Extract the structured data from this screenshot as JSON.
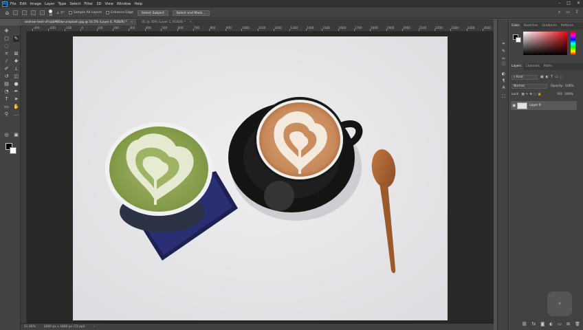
{
  "app": {
    "logo": "Ps"
  },
  "menu": [
    "File",
    "Edit",
    "Image",
    "Layer",
    "Type",
    "Select",
    "Filter",
    "3D",
    "View",
    "Window",
    "Help"
  ],
  "options": {
    "brush_size": "30",
    "sample_all_layers": "Sample All Layers",
    "enhance_edge": "Enhance Edge",
    "select_subject": "Select Subject",
    "select_and_mask": "Select and Mask..."
  },
  "tabs": [
    {
      "label": "andrew-teoh-xFsxjbM8Uw-unsplash.jpg @ 54.5% (Layer 0, RGB/8) *",
      "close": "×"
    },
    {
      "label": "01 @ 30% (Layer 1, RGB/8) *",
      "close": "×"
    }
  ],
  "ruler_labels": [
    "-300",
    "-200",
    "-100",
    "0",
    "100",
    "200",
    "300",
    "400",
    "500",
    "600",
    "700",
    "800",
    "900",
    "1000",
    "1100",
    "1200",
    "1300",
    "1400",
    "1500",
    "1600",
    "1700",
    "1800",
    "1900",
    "2000",
    "2100",
    "2200",
    "2300",
    "2400",
    "2500",
    "2600"
  ],
  "status": {
    "zoom": "51.46%",
    "doc_info": "2400 px x 1800 px (72 ppi)",
    "arrow": "›"
  },
  "color_panel": {
    "tabs": [
      "Color",
      "Swatches",
      "Gradients",
      "Patterns"
    ]
  },
  "layers_panel": {
    "tabs": [
      "Layers",
      "Channels",
      "Paths"
    ],
    "filter": "Kind",
    "blend_mode": "Normal",
    "opacity_label": "Opacity:",
    "opacity_value": "100%",
    "lock_label": "Lock:",
    "fill_label": "Fill:",
    "fill_value": "100%",
    "layer_name": "Layer 0"
  },
  "colors": {
    "accent": "#31a8ff",
    "app_bg": "#535353",
    "panel": "#424242",
    "menubar": "#323232"
  }
}
